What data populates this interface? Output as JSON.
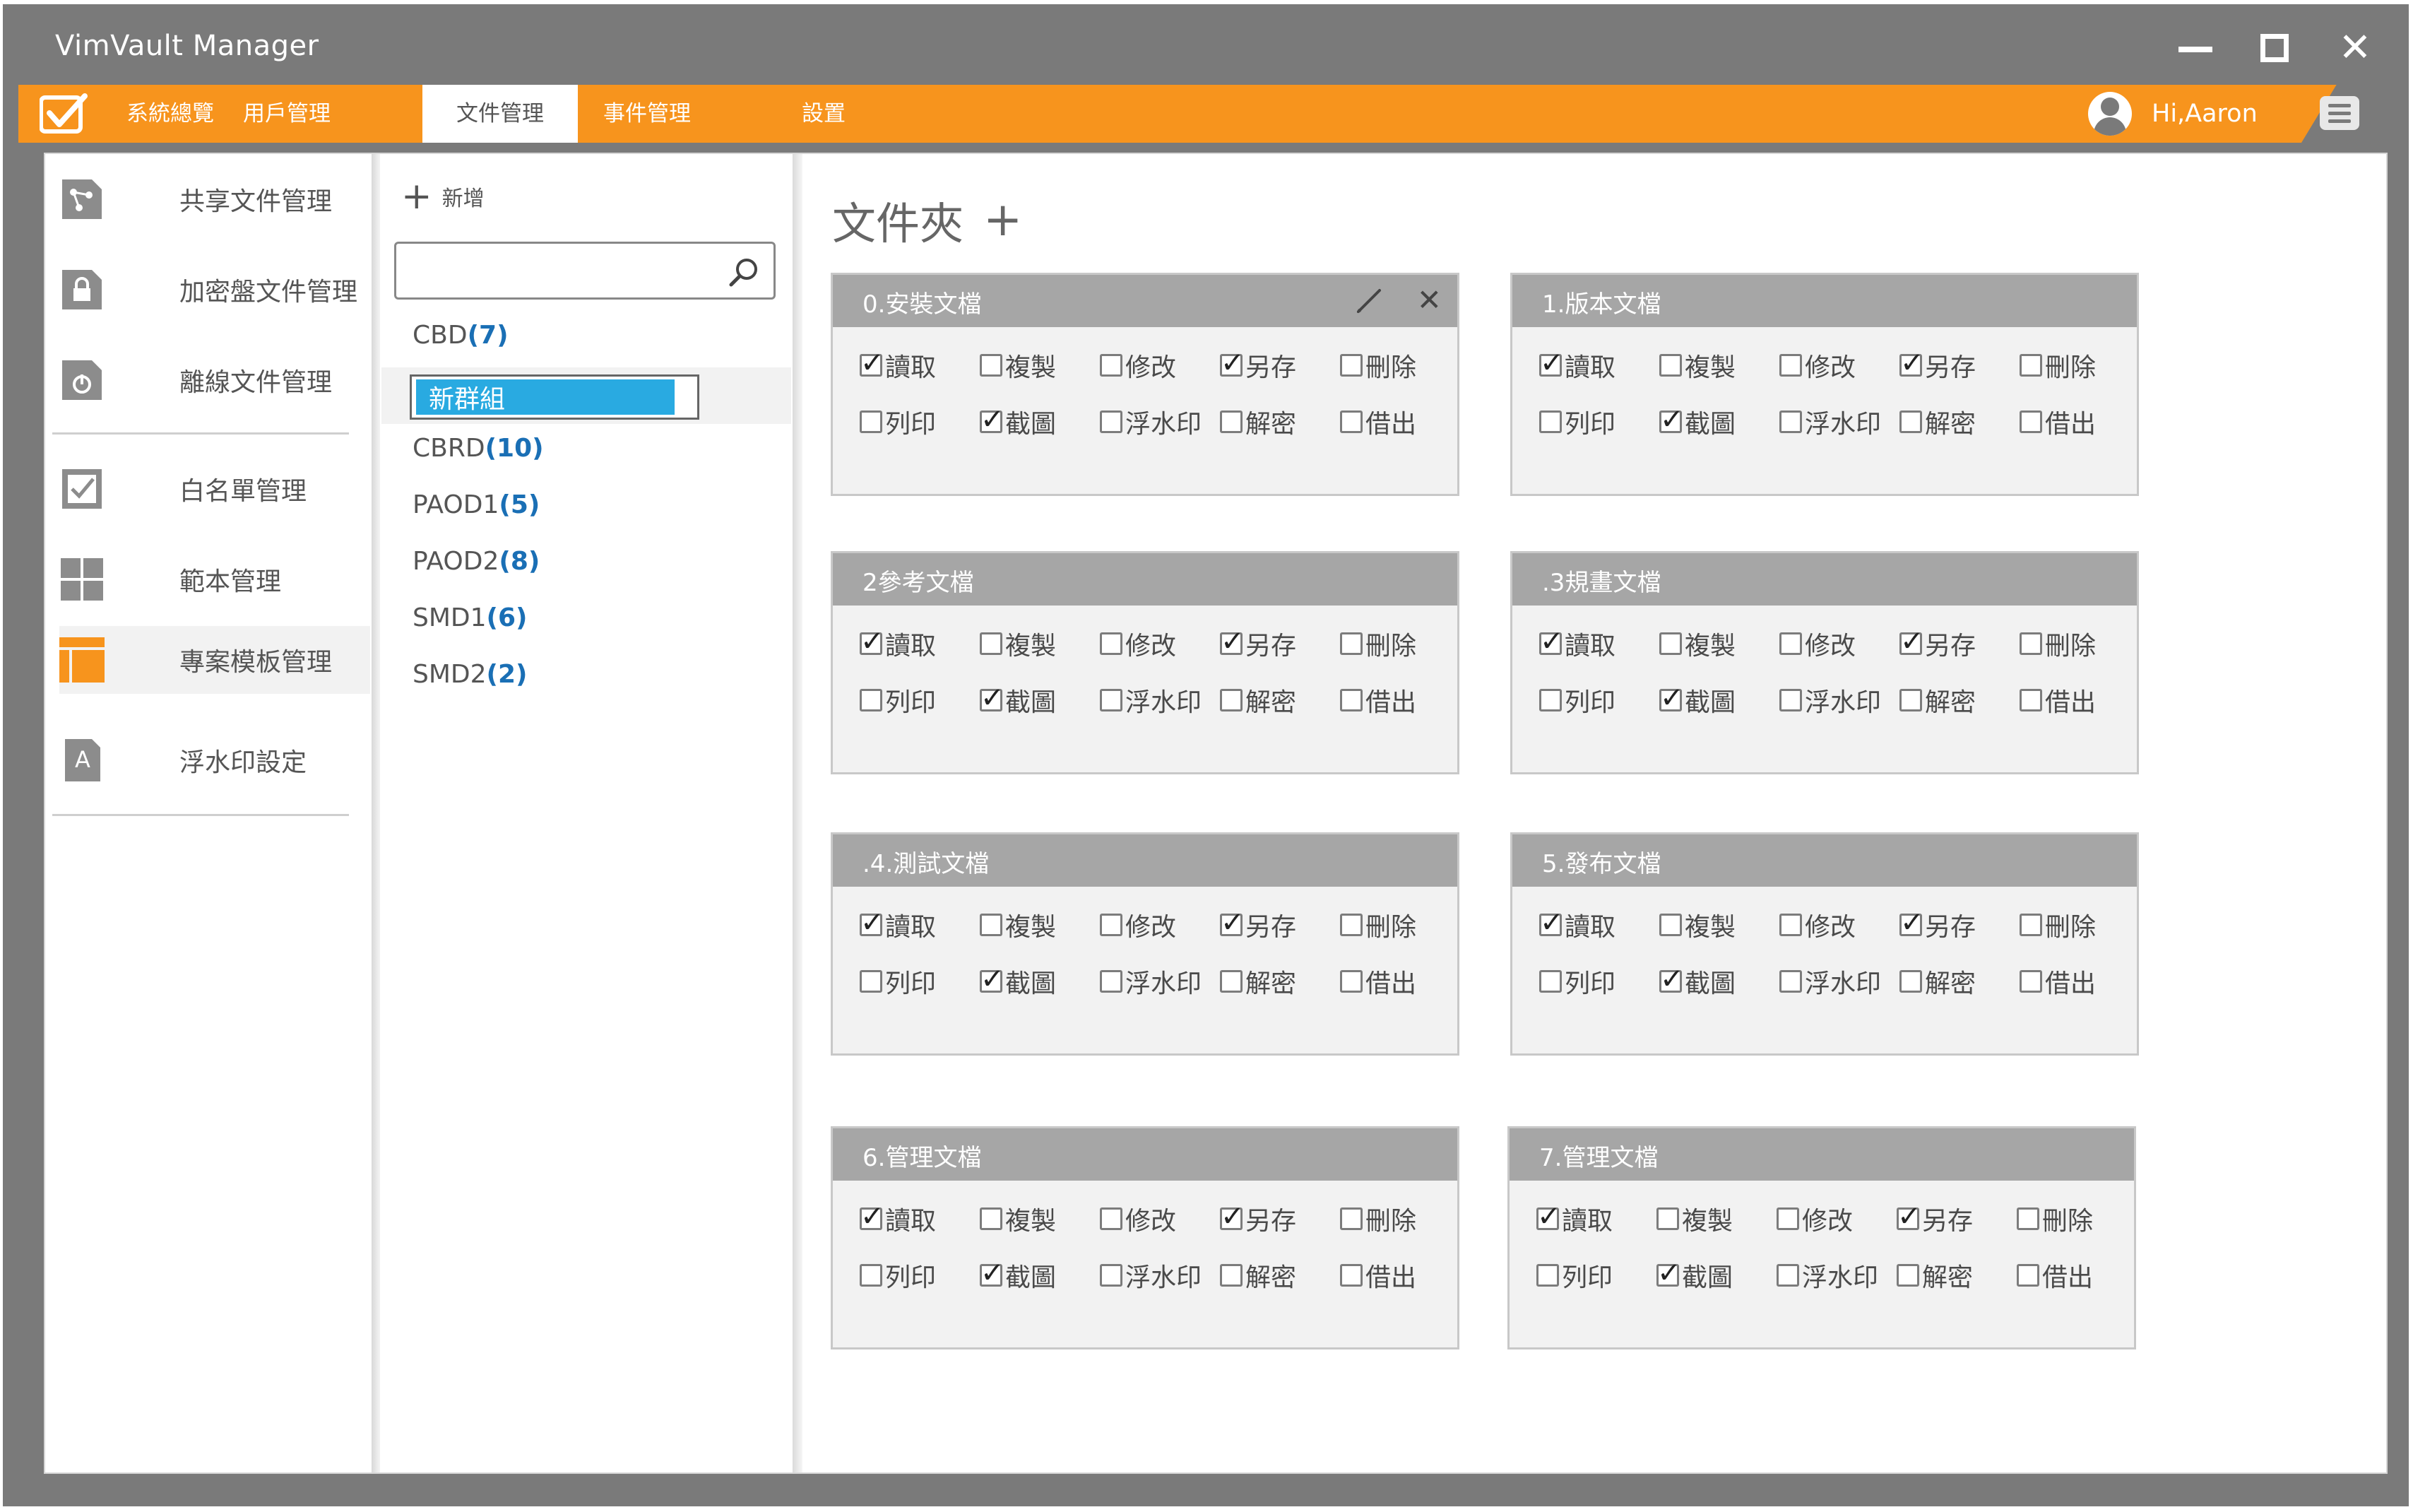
{
  "window": {
    "title": "VimVault Manager"
  },
  "nav": {
    "tabs": [
      "系統總覽",
      "用戶管理",
      "文件管理",
      "事件管理",
      "設置"
    ],
    "active_tab": "文件管理",
    "user_greeting": "Hi,Aaron"
  },
  "sidebar": {
    "items": [
      "共享文件管理",
      "加密盤文件管理",
      "離線文件管理",
      "白名單管理",
      "範本管理",
      "專案模板管理",
      "浮水印設定"
    ],
    "active_item": "專案模板管理",
    "watermark_icon_letter": "A"
  },
  "groups": {
    "add_label": "新增",
    "search_placeholder": "",
    "new_group_value": "新群組",
    "list": [
      {
        "name": "CBD",
        "count": "(7)"
      },
      {
        "name": "CBRD",
        "count": "(10)"
      },
      {
        "name": "PAOD1",
        "count": "(5)"
      },
      {
        "name": "PAOD2",
        "count": "(8)"
      },
      {
        "name": "SMD1",
        "count": "(6)"
      },
      {
        "name": "SMD2",
        "count": "(2)"
      }
    ]
  },
  "main": {
    "title": "文件夾",
    "add_icon": "+",
    "permission_labels": [
      "讀取",
      "複製",
      "修改",
      "另存",
      "刪除",
      "列印",
      "截圖",
      "浮水印",
      "解密",
      "借出"
    ],
    "cards": [
      {
        "title": "0.安裝文檔",
        "checked": [
          true,
          false,
          false,
          true,
          false,
          false,
          true,
          false,
          false,
          false
        ]
      },
      {
        "title": "1.版本文檔",
        "checked": [
          true,
          false,
          false,
          true,
          false,
          false,
          true,
          false,
          false,
          false
        ]
      },
      {
        "title": "2參考文檔",
        "checked": [
          true,
          false,
          false,
          true,
          false,
          false,
          true,
          false,
          false,
          false
        ]
      },
      {
        "title": ".3規畫文檔",
        "checked": [
          true,
          false,
          false,
          true,
          false,
          false,
          true,
          false,
          false,
          false
        ]
      },
      {
        "title": ".4.測試文檔",
        "checked": [
          true,
          false,
          false,
          true,
          false,
          false,
          true,
          false,
          false,
          false
        ]
      },
      {
        "title": "5.發布文檔",
        "checked": [
          true,
          false,
          false,
          true,
          false,
          false,
          true,
          false,
          false,
          false
        ]
      },
      {
        "title": "6.管理文檔",
        "checked": [
          true,
          false,
          false,
          true,
          false,
          false,
          true,
          false,
          false,
          false
        ]
      },
      {
        "title": "7.管理文檔",
        "checked": [
          true,
          false,
          false,
          true,
          false,
          false,
          true,
          false,
          false,
          false
        ]
      }
    ]
  },
  "colors": {
    "accent": "#f7941d",
    "window_frame": "#7a7a7a",
    "selection": "#29aae1",
    "count_text": "#1a6fb5",
    "card_header": "#a6a6a6"
  }
}
